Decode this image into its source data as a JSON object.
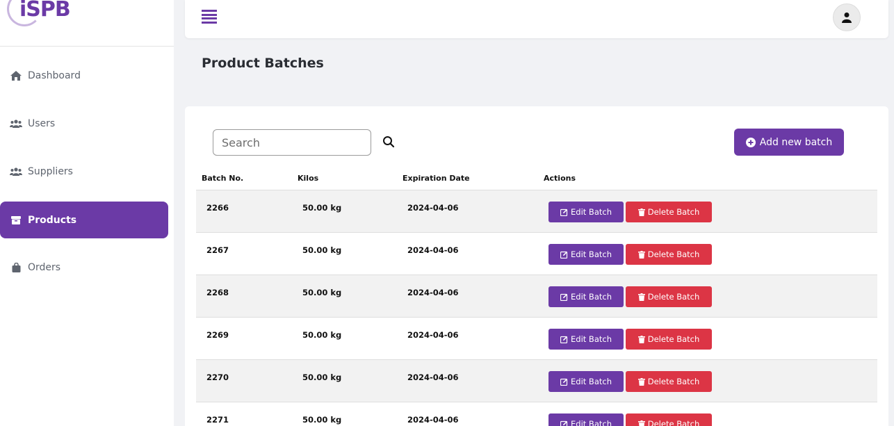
{
  "app": {
    "logo_text": "iSPB"
  },
  "sidebar": {
    "items": [
      {
        "label": "Dashboard",
        "icon": "home-icon",
        "active": false
      },
      {
        "label": "Users",
        "icon": "users-icon",
        "active": false
      },
      {
        "label": "Suppliers",
        "icon": "suppliers-icon",
        "active": false
      },
      {
        "label": "Products",
        "icon": "box-icon",
        "active": true
      },
      {
        "label": "Orders",
        "icon": "shopping-bag-icon",
        "active": false
      }
    ]
  },
  "topbar": {
    "menu_icon": "hamburger-icon",
    "avatar_icon": "user-icon"
  },
  "page": {
    "title": "Product Batches"
  },
  "search": {
    "placeholder": "Search",
    "value": ""
  },
  "toolbar": {
    "add_label": "Add new batch"
  },
  "table": {
    "headers": [
      "Batch No.",
      "Kilos",
      "Expiration Date",
      "Actions"
    ],
    "edit_label": "Edit Batch",
    "delete_label": "Delete Batch",
    "rows": [
      {
        "batch_no": "2266",
        "kilos": "50.00 kg",
        "expiration": "2024-04-06"
      },
      {
        "batch_no": "2267",
        "kilos": "50.00 kg",
        "expiration": "2024-04-06"
      },
      {
        "batch_no": "2268",
        "kilos": "50.00 kg",
        "expiration": "2024-04-06"
      },
      {
        "batch_no": "2269",
        "kilos": "50.00 kg",
        "expiration": "2024-04-06"
      },
      {
        "batch_no": "2270",
        "kilos": "50.00 kg",
        "expiration": "2024-04-06"
      },
      {
        "batch_no": "2271",
        "kilos": "50.00 kg",
        "expiration": "2024-04-06"
      }
    ]
  },
  "colors": {
    "brand": "#6b3aa6",
    "danger": "#dc3545"
  }
}
